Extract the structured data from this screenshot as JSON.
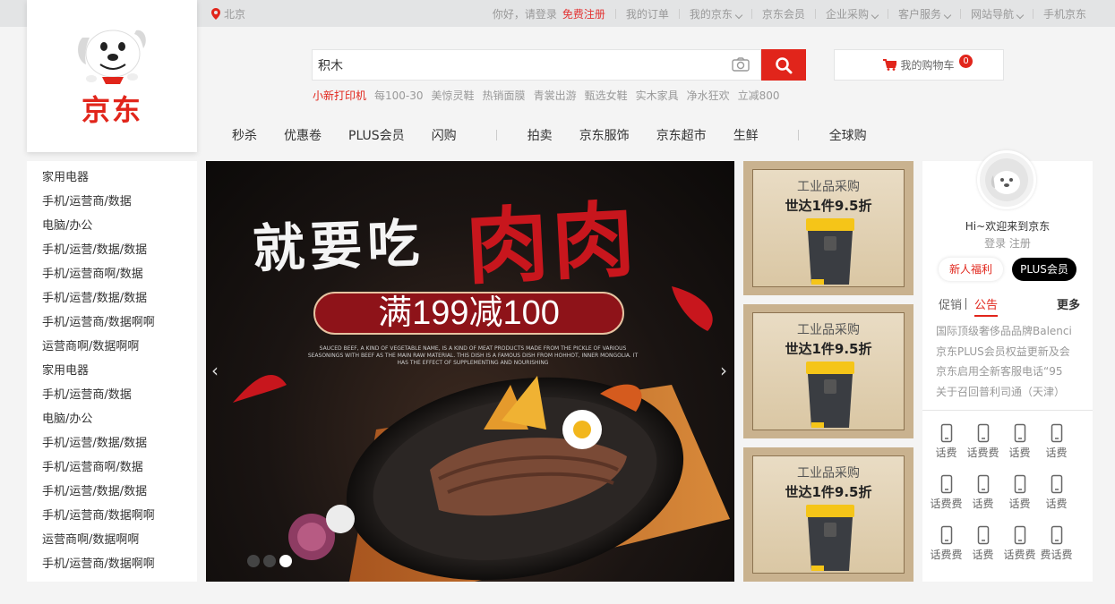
{
  "topbar": {
    "location": "北京",
    "greeting": "你好，请登录",
    "register": "免费注册",
    "links": [
      "我的订单",
      "我的京东",
      "京东会员",
      "企业采购",
      "客户服务",
      "网站导航",
      "手机京东"
    ],
    "chevron_links": [
      false,
      true,
      false,
      true,
      true,
      true,
      false
    ]
  },
  "logo": {
    "brand": "京东"
  },
  "search": {
    "value": "积木",
    "camera_icon": "camera-icon",
    "button_icon": "search-icon"
  },
  "hotwords": [
    "小新打印机",
    "每100-30",
    "美惊灵鞋",
    "热销面膜",
    "青裳出游",
    "甄选女鞋",
    "实木家具",
    "净水狂欢",
    "立减800"
  ],
  "cart": {
    "label": "我的购物车",
    "count": "0"
  },
  "nav": [
    "秒杀",
    "优惠卷",
    "PLUS会员",
    "闪购",
    "拍卖",
    "京东服饰",
    "京东超市",
    "生鲜",
    "全球购"
  ],
  "categories": [
    "家用电器",
    "手机/运营商/数据",
    "电脑/办公",
    "手机/运营/数据/数据",
    "手机/运营商啊/数据",
    "手机/运营/数据/数据",
    "手机/运营商/数据啊啊",
    "运营商啊/数据啊啊",
    "家用电器",
    "手机/运营商/数据",
    "电脑/办公",
    "手机/运营/数据/数据",
    "手机/运营商啊/数据",
    "手机/运营/数据/数据",
    "手机/运营商/数据啊啊",
    "运营商啊/数据啊啊",
    "手机/运营商/数据啊啊"
  ],
  "banner": {
    "title_white": "就要吃",
    "title_red": "肉肉",
    "offer": "满199减100",
    "fine_print": "SAUCED BEEF, A KIND OF VEGETABLE NAME, IS A KIND OF MEAT PRODUCTS MADE FROM THE PICKLE OF VARIOUS SEASONINGS WITH BEEF AS THE MAIN RAW MATERIAL. THIS DISH IS A FAMOUS DISH FROM HOHHOT, INNER MONGOLIA. IT HAS THE EFFECT OF SUPPLEMENTING AND NOURISHING",
    "prev": "‹",
    "next": "›",
    "active_dot": 2
  },
  "promos": [
    {
      "tag": "工业品采购",
      "title": "世达1件9.5折"
    },
    {
      "tag": "工业品采购",
      "title": "世达1件9.5折"
    },
    {
      "tag": "工业品采购",
      "title": "世达1件9.5折"
    }
  ],
  "user": {
    "hi": "Hi~欢迎来到京东",
    "login": "登录 注册",
    "btn_new": "新人福利",
    "btn_plus": "PLUS会员",
    "tab_promo": "促销",
    "tab_notice": "公告",
    "more": "更多",
    "news": [
      "国际顶级奢侈品品牌Balenci",
      "京东PLUS会员权益更新及会",
      "京东启用全新客服电话“95",
      "关于召回普利司通（天津）"
    ],
    "services": [
      "话费",
      "话费费",
      "话费",
      "话费",
      "话费费",
      "话费",
      "话费",
      "话费",
      "话费费",
      "话费",
      "话费费",
      "费话费"
    ]
  },
  "colors": {
    "brand_red": "#e1251b",
    "topbar_bg": "#e3e4e5",
    "page_bg": "#f4f4f4"
  }
}
